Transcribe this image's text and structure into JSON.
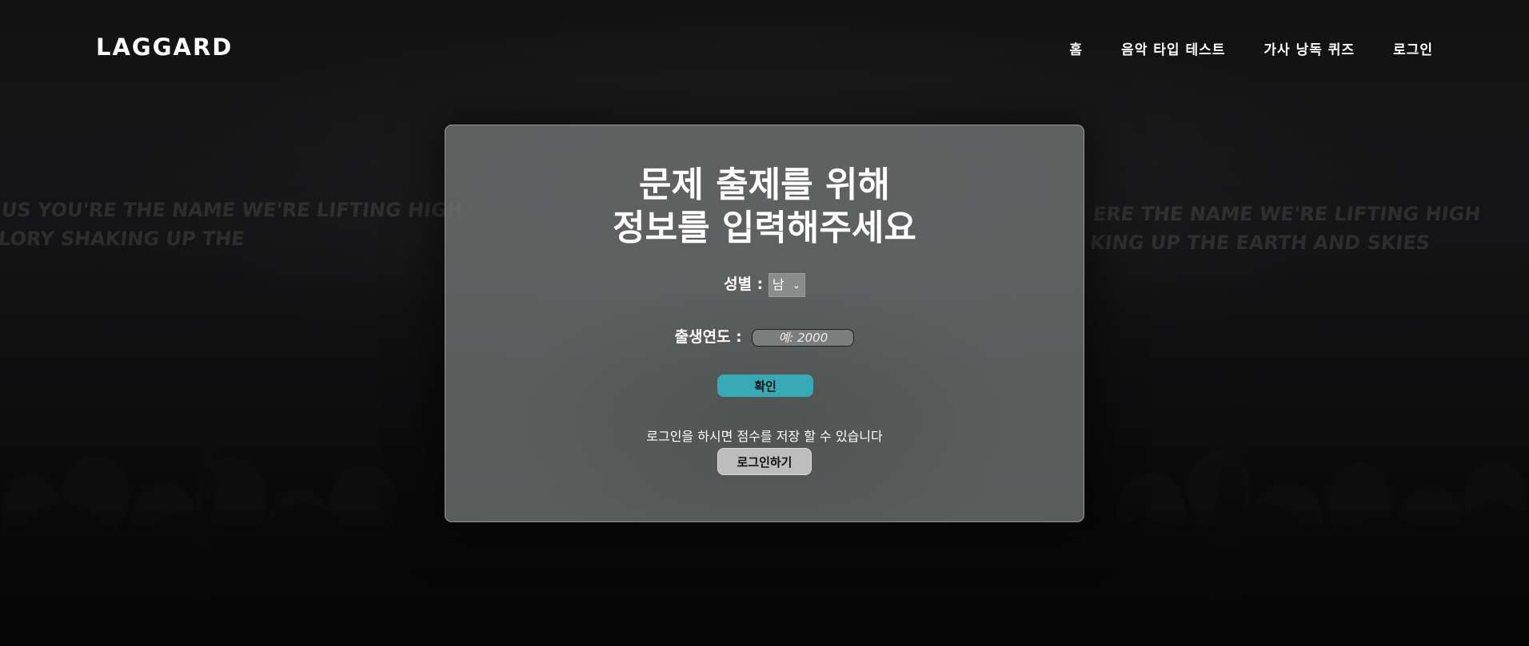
{
  "header": {
    "brand": "LAGGARD",
    "nav": {
      "home": "홈",
      "music_type_test": "음악 타입 테스트",
      "lyrics_quiz": "가사 낭독 퀴즈",
      "login": "로그인"
    }
  },
  "background": {
    "banner_left_line1": "US YOU'RE THE NAME WE'RE LIFTING HIGH",
    "banner_left_line2": "LORY SHAKING UP THE",
    "banner_right_line1": "ERE THE NAME WE'RE LIFTING HIGH",
    "banner_right_line2": "KING UP THE EARTH AND SKIES"
  },
  "card": {
    "title_line1": "문제 출제를 위해",
    "title_line2": "정보를 입력해주세요",
    "gender_label": "성별 :",
    "gender_selected": "남",
    "birth_year_label": "출생연도 :",
    "birth_year_value": "",
    "birth_year_placeholder": "예: 2000",
    "confirm_label": "확인",
    "login_hint": "로그인을 하시면 점수를 저장 할 수 있습니다",
    "login_button_label": "로그인하기"
  },
  "colors": {
    "accent": "#3aa9b6",
    "card_background": "#6e7070",
    "login_button": "#bdbdbd",
    "page_background": "#0d0d0e"
  },
  "icons": {
    "select_chevron": "chevron-down-icon"
  }
}
